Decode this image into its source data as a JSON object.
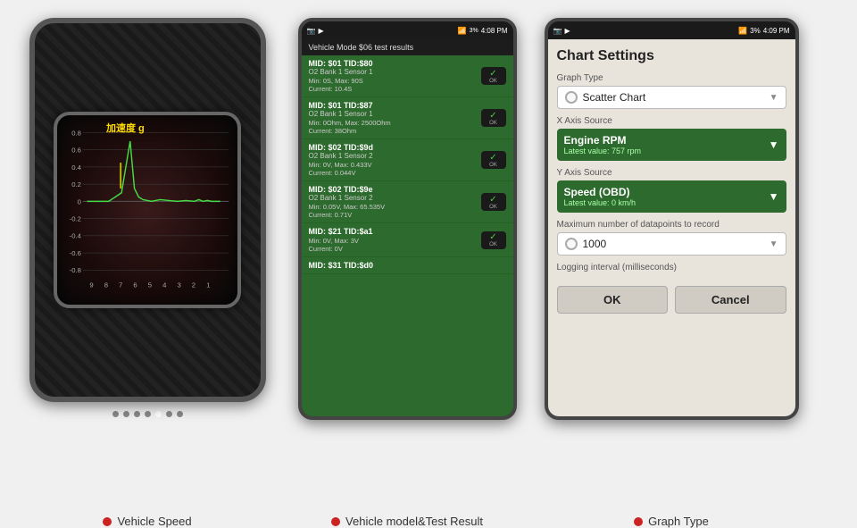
{
  "panel1": {
    "chart_title": "加速度 g",
    "y_labels": [
      "0.8",
      "0.6",
      "0.4",
      "0.2",
      "0",
      "-0.2",
      "-0.4",
      "-0.6",
      "-0.8"
    ],
    "x_labels": [
      "9",
      "8",
      "7",
      "6",
      "5",
      "4",
      "3",
      "2",
      "1"
    ],
    "dots": [
      "",
      "",
      "",
      "",
      "active",
      "",
      "",
      "",
      "",
      ""
    ],
    "label": "Vehicle Speed"
  },
  "panel2": {
    "status_time": "4:08 PM",
    "status_battery": "3%",
    "header": "Vehicle Mode $06 test results",
    "items": [
      {
        "title": "MID: $01 TID:$80",
        "sub": "O2 Bank 1 Sensor 1",
        "values": "Min: 0S, Max: 90S\nCurrent: 10.4S",
        "ok": true
      },
      {
        "title": "MID: $01 TID:$87",
        "sub": "O2 Bank 1 Sensor 1",
        "values": "Min: 0Ohm, Max: 2500Ohm\nCurrent: 38Ohm",
        "ok": true
      },
      {
        "title": "MID: $02 TID:$9d",
        "sub": "O2 Bank 1 Sensor 2",
        "values": "Min: 0V, Max: 0.433V\nCurrent: 0.044V",
        "ok": true
      },
      {
        "title": "MID: $02 TID:$9e",
        "sub": "O2 Bank 1 Sensor 2",
        "values": "Min: 0.05V, Max: 65.535V\nCurrent: 0.71V",
        "ok": true
      },
      {
        "title": "MID: $21 TID:$a1",
        "sub": "",
        "values": "Min: 0V, Max: 3V\nCurrent: 0V",
        "ok": true
      },
      {
        "title": "MID: $31 TID:$d0",
        "sub": "",
        "values": "",
        "ok": false
      }
    ],
    "label": "Vehicle model&Test Result"
  },
  "panel3": {
    "status_time": "4:09 PM",
    "status_battery": "3%",
    "title": "Chart Settings",
    "graph_type_label": "Graph Type",
    "graph_type_value": "Scatter Chart",
    "x_axis_label": "X Axis Source",
    "x_axis_value": "Engine RPM",
    "x_axis_sub": "Latest value: 757 rpm",
    "y_axis_label": "Y Axis Source",
    "y_axis_value": "Speed (OBD)",
    "y_axis_sub": "Latest value: 0 km/h",
    "max_dp_label": "Maximum number of datapoints to record",
    "max_dp_value": "1000",
    "log_interval_label": "Logging interval (milliseconds)",
    "ok_button": "OK",
    "cancel_button": "Cancel",
    "label": "Graph Type"
  }
}
